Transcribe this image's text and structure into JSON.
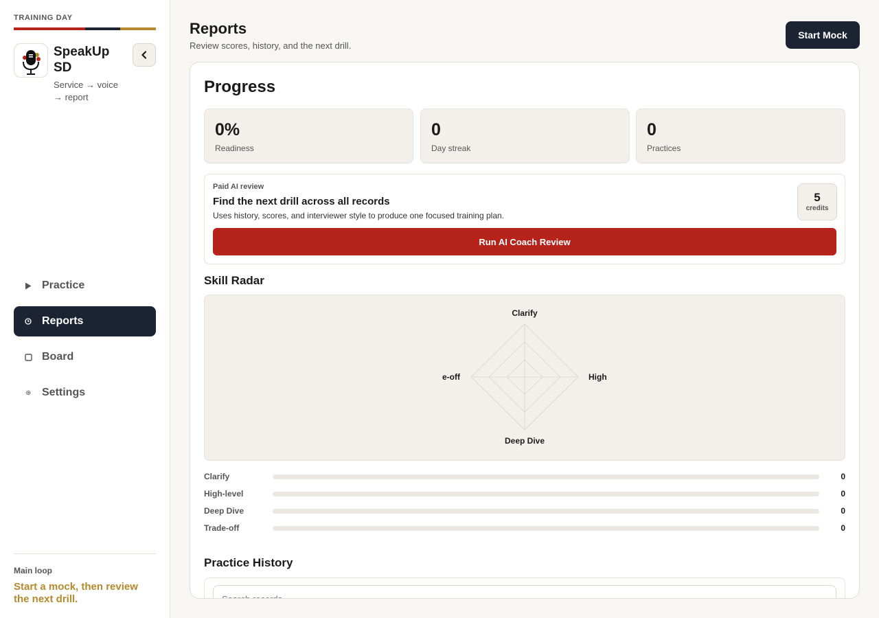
{
  "sidebar": {
    "eyebrow": "TRAINING DAY",
    "stripe_colors": [
      "#b5231b",
      "#1c2433",
      "#b5892e"
    ],
    "app_name": "SpeakUp SD",
    "app_tagline": "Service → voice → report",
    "logo_icon": "microphone-icon",
    "collapse_icon": "chevron-left-icon",
    "nav": [
      {
        "label": "Practice",
        "icon": "play-icon",
        "active": false
      },
      {
        "label": "Reports",
        "icon": "clock-icon",
        "active": true
      },
      {
        "label": "Board",
        "icon": "square-icon",
        "active": false
      },
      {
        "label": "Settings",
        "icon": "gear-icon",
        "active": false
      }
    ],
    "footer_label": "Main loop",
    "footer_message": "Start a mock, then review the next drill."
  },
  "header": {
    "title": "Reports",
    "subtitle": "Review scores, history, and the next drill.",
    "start_button": "Start Mock"
  },
  "progress": {
    "title": "Progress",
    "stats": [
      {
        "value": "0%",
        "label": "Readiness"
      },
      {
        "value": "0",
        "label": "Day streak"
      },
      {
        "value": "0",
        "label": "Practices"
      }
    ]
  },
  "ai_review": {
    "kicker": "Paid AI review",
    "title": "Find the next drill across all records",
    "description": "Uses history, scores, and interviewer style to produce one focused training plan.",
    "credits_value": "5",
    "credits_label": "credits",
    "button": "Run AI Coach Review"
  },
  "skills": {
    "title": "Skill Radar",
    "radar_labels": {
      "top": "Clarify",
      "right": "High",
      "bottom": "Deep Dive",
      "left": "e-off"
    },
    "items": [
      {
        "label": "Clarify",
        "value": 0
      },
      {
        "label": "High-level",
        "value": 0
      },
      {
        "label": "Deep Dive",
        "value": 0
      },
      {
        "label": "Trade-off",
        "value": 0
      }
    ]
  },
  "history": {
    "title": "Practice History",
    "search_placeholder": "Search records"
  },
  "colors": {
    "accent_red": "#b5231b",
    "navy": "#1c2433",
    "gold": "#b5892e"
  }
}
